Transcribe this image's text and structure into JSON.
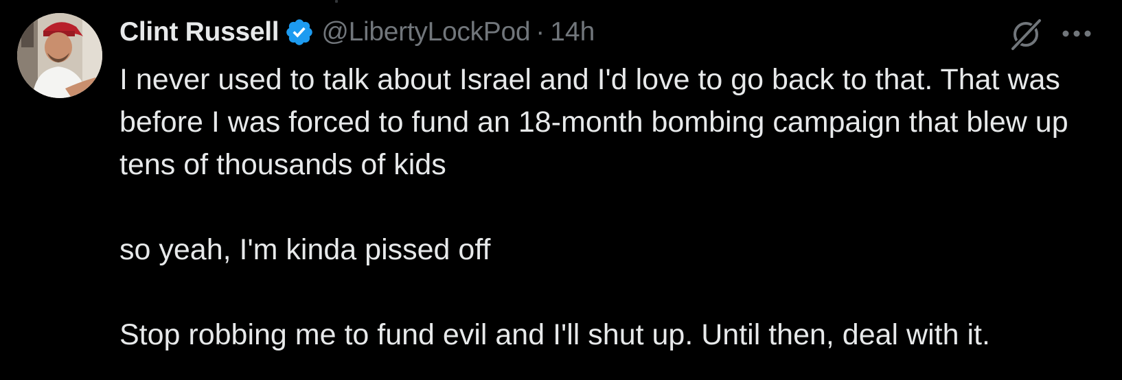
{
  "tweet": {
    "author": {
      "display_name": "Clint Russell",
      "verified": true,
      "handle": "@LibertyLockPod",
      "avatar_icon": "user-avatar"
    },
    "separator": "·",
    "time": "14h",
    "actions": {
      "grok_icon": "grok-icon",
      "more_icon": "more-dots-icon"
    },
    "text": {
      "paragraph_1": "I never used to talk about Israel and I'd love to go back to that. That was before I was forced to fund an 18-month bombing campaign that blew up tens of thousands of kids",
      "paragraph_2": "so yeah, I'm kinda pissed off",
      "paragraph_3": "Stop robbing me to fund evil and I'll shut up. Until then, deal with it."
    }
  },
  "colors": {
    "background": "#000000",
    "primary_text": "#e7e9ea",
    "secondary_text": "#71767b",
    "verified_blue": "#1d9bf0"
  }
}
